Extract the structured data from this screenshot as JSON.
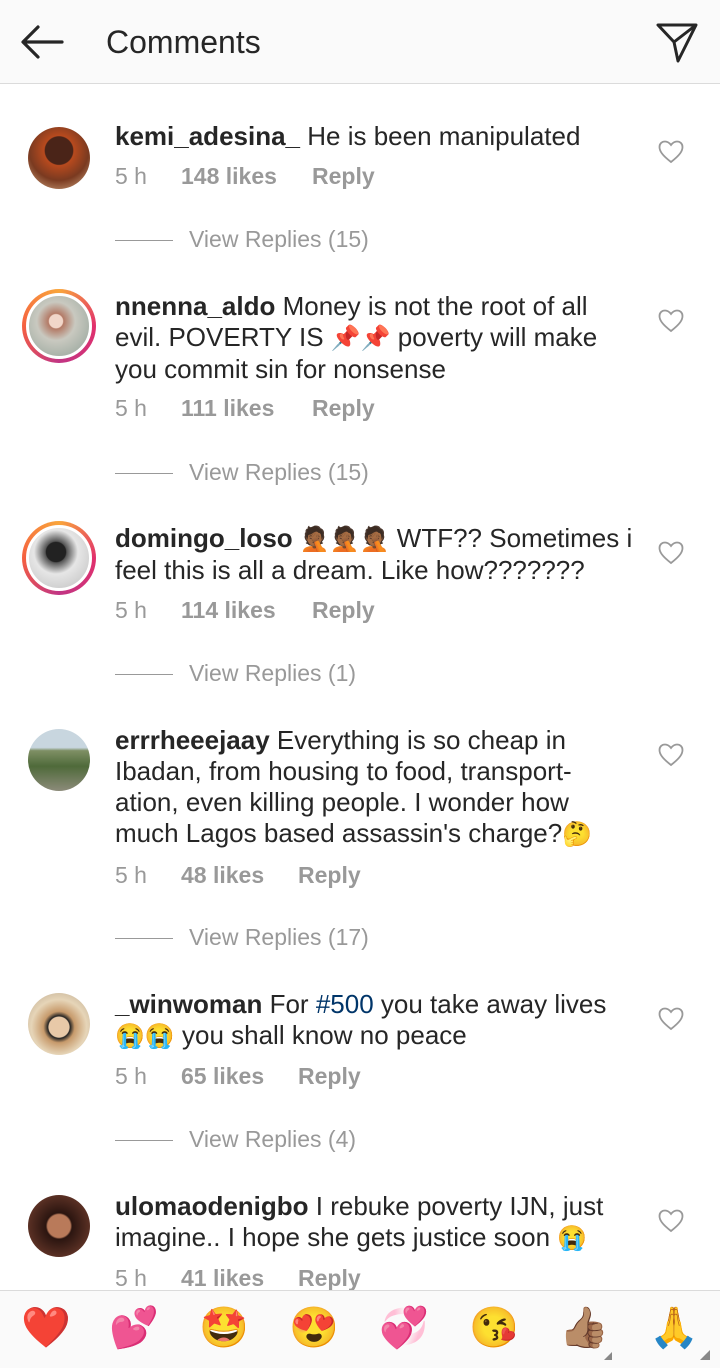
{
  "header": {
    "title": "Comments",
    "back_icon": "arrow-left-icon",
    "send_icon": "paper-plane-icon"
  },
  "comments": [
    {
      "username": "kemi_adesina_",
      "text": "He is been manipulated",
      "time": "5 h",
      "likes": "148 likes",
      "reply": "Reply",
      "view_replies": "View Replies (15)",
      "story_ring": false,
      "avatar_color": "#6b3b2e"
    },
    {
      "username": "nnenna_aldo",
      "text_before": "Money is not the root of all evil. POVERTY IS ",
      "emoji": "📌📌",
      "text_after": " poverty will make you commit sin for nonsense",
      "time": "5 h",
      "likes": "111 likes",
      "reply": "Reply",
      "view_replies": "View Replies (15)",
      "story_ring": true,
      "avatar_color": "#9aa7a0"
    },
    {
      "username": "domingo_loso",
      "emoji": "🤦🏾🤦🏾🤦🏾",
      "text": " WTF?? Sometimes i feel this is all a dream. Like how???????",
      "time": "5 h",
      "likes": "114 likes",
      "reply": "Reply",
      "view_replies": "View Replies (1)",
      "story_ring": true,
      "avatar_color": "#3a3a3a"
    },
    {
      "username": "errrheeejaay",
      "text": "Everything is so cheap in Ibadan, from housing to food, transport-ation, even killing people. I wonder how much Lagos based assassin's charge?",
      "emoji": "🤔",
      "time": "5 h",
      "likes": "48 likes",
      "reply": "Reply",
      "view_replies": "View Replies (17)",
      "story_ring": false,
      "avatar_color": "#6d7d5e"
    },
    {
      "username": "_winwoman",
      "text_before": "For ",
      "hashtag": "#500",
      "text_after": " you take away lives",
      "emoji": "😭😭",
      "text_end": " you shall know no peace",
      "time": "5 h",
      "likes": "65 likes",
      "reply": "Reply",
      "view_replies": "View Replies (4)",
      "story_ring": false,
      "avatar_color": "#c9a57a"
    },
    {
      "username": "ulomaodenigbo",
      "text": "I rebuke poverty IJN, just imagine.. I hope she gets justice soon ",
      "emoji": "😭",
      "time": "5 h",
      "likes": "41 likes",
      "reply": "Reply",
      "story_ring": false,
      "avatar_color": "#4a2a22"
    }
  ],
  "emoji_bar": [
    "❤️",
    "💕",
    "🤩",
    "😍",
    "💞",
    "😘",
    "👍🏽",
    "🙏"
  ],
  "colors": {
    "text": "#262626",
    "secondary": "#999999",
    "hashtag": "#003569",
    "header_bg": "#fafafa"
  }
}
